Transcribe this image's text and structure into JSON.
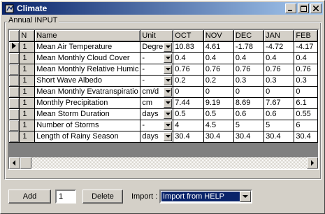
{
  "window": {
    "title": "Climate",
    "controls": {
      "minimize": "minimize-icon",
      "maximize": "maximize-icon",
      "close": "close-icon"
    }
  },
  "group": {
    "caption": "Annual INPUT"
  },
  "table": {
    "headers": [
      "N",
      "Name",
      "Unit",
      "OCT",
      "NOV",
      "DEC",
      "JAN",
      "FEB"
    ],
    "rows": [
      {
        "n": "1",
        "name": "Mean Air Temperature",
        "unit": "Degre",
        "oct": "10.83",
        "nov": "4.61",
        "dec": "-1.78",
        "jan": "-4.72",
        "feb": "-4.17"
      },
      {
        "n": "1",
        "name": "Mean Monthly Cloud Cover",
        "unit": "-",
        "oct": "0.4",
        "nov": "0.4",
        "dec": "0.4",
        "jan": "0.4",
        "feb": "0.4"
      },
      {
        "n": "1",
        "name": "Mean Monthly Relative Humic",
        "unit": "-",
        "oct": "0.76",
        "nov": "0.76",
        "dec": "0.76",
        "jan": "0.76",
        "feb": "0.76"
      },
      {
        "n": "1",
        "name": "Short Wave Albedo",
        "unit": "-",
        "oct": "0.2",
        "nov": "0.2",
        "dec": "0.3",
        "jan": "0.3",
        "feb": "0.3"
      },
      {
        "n": "1",
        "name": "Mean Monthly Evatranspiratio",
        "unit": "cm/d",
        "oct": "0",
        "nov": "0",
        "dec": "0",
        "jan": "0",
        "feb": "0"
      },
      {
        "n": "1",
        "name": "Monthly Precipitation",
        "unit": "cm",
        "oct": "7.44",
        "nov": "9.19",
        "dec": "8.69",
        "jan": "7.67",
        "feb": "6.1"
      },
      {
        "n": "1",
        "name": "Mean Storm Duration",
        "unit": "days",
        "oct": "0.5",
        "nov": "0.5",
        "dec": "0.6",
        "jan": "0.6",
        "feb": "0.55"
      },
      {
        "n": "1",
        "name": "Number of Storms",
        "unit": "-",
        "oct": "4",
        "nov": "4.5",
        "dec": "5",
        "jan": "5",
        "feb": "6"
      },
      {
        "n": "1",
        "name": "Length of Rainy Season",
        "unit": "days",
        "oct": "30.4",
        "nov": "30.4",
        "dec": "30.4",
        "jan": "30.4",
        "feb": "30.4"
      }
    ],
    "current_row_icon": "row-pointer-icon"
  },
  "footer": {
    "add_label": "Add",
    "count_value": "1",
    "delete_label": "Delete",
    "import_label": "Import :",
    "import_selected": "Import from HELP"
  },
  "colors": {
    "title_start": "#0a246a",
    "title_end": "#a6caf0",
    "face": "#d4d0c8",
    "selection": "#0a246a"
  }
}
